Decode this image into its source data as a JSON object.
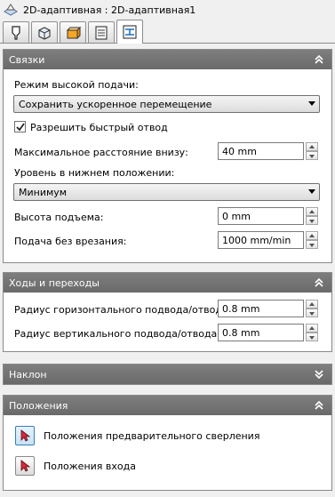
{
  "window": {
    "title": "2D-адаптивная : 2D-адаптивная1"
  },
  "tabs": [
    {
      "name": "tool"
    },
    {
      "name": "geometry"
    },
    {
      "name": "layers"
    },
    {
      "name": "list"
    },
    {
      "name": "links",
      "active": true
    }
  ],
  "links": {
    "title": "Связки",
    "high_feed_label": "Режим высокой подачи:",
    "high_feed_value": "Сохранить ускоренное перемещение",
    "fast_retract_label": "Разрешить быстрый отвод",
    "fast_retract_checked": true,
    "max_down_label": "Максимальное расстояние внизу:",
    "max_down_value": "40 mm",
    "low_level_label": "Уровень в нижнем положении:",
    "low_level_value": "Минимум",
    "lift_height_label": "Высота подъема:",
    "lift_height_value": "0 mm",
    "no_engage_feed_label": "Подача без врезания:",
    "no_engage_feed_value": "1000 mm/min"
  },
  "passes": {
    "title": "Ходы и переходы",
    "h_radius_label": "Радиус горизонтального подвода/отвода:",
    "h_radius_value": "0.8 mm",
    "v_radius_label": "Радиус вертикального подвода/отвода:",
    "v_radius_value": "0.8 mm"
  },
  "tilt": {
    "title": "Наклон"
  },
  "positions": {
    "title": "Положения",
    "predrill_label": "Положения предварительного сверления",
    "entry_label": "Положения входа"
  }
}
